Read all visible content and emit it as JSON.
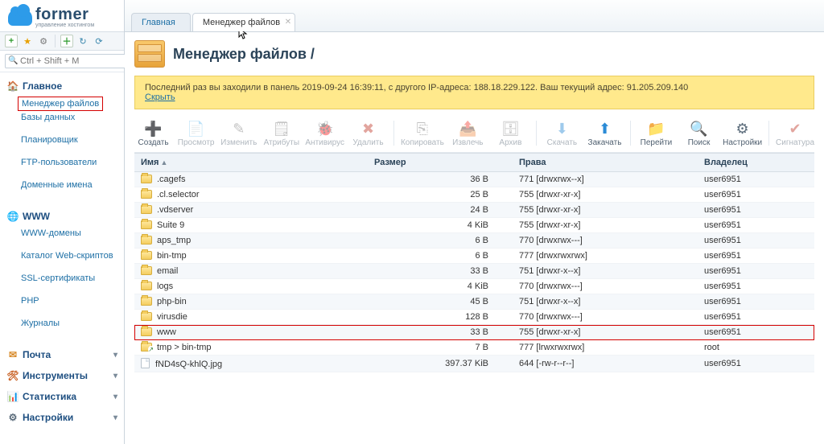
{
  "brand": {
    "name": "former",
    "tagline": "управление хостингом"
  },
  "search": {
    "placeholder": "Ctrl + Shift + M"
  },
  "nav": [
    {
      "label": "Главное",
      "icon": "home",
      "expanded": true,
      "items": [
        {
          "label": "Менеджер файлов",
          "highlight": true
        },
        {
          "label": "Базы данных"
        },
        {
          "label": "Планировщик"
        },
        {
          "label": "FTP-пользователи"
        },
        {
          "label": "Доменные имена"
        }
      ]
    },
    {
      "label": "WWW",
      "icon": "globe",
      "expanded": true,
      "items": [
        {
          "label": "WWW-домены"
        },
        {
          "label": "Каталог Web-скриптов"
        },
        {
          "label": "SSL-сертификаты"
        },
        {
          "label": "PHP"
        },
        {
          "label": "Журналы"
        }
      ]
    },
    {
      "label": "Почта",
      "icon": "mail",
      "expanded": false
    },
    {
      "label": "Инструменты",
      "icon": "tools",
      "expanded": false
    },
    {
      "label": "Статистика",
      "icon": "stats",
      "expanded": false
    },
    {
      "label": "Настройки",
      "icon": "gear",
      "expanded": false
    }
  ],
  "tabs": [
    {
      "label": "Главная",
      "active": false,
      "closable": false
    },
    {
      "label": "Менеджер файлов",
      "active": true,
      "closable": true
    }
  ],
  "page": {
    "title": "Менеджер файлов /"
  },
  "notice": {
    "text": "Последний раз вы заходили в панель 2019-09-24 16:39:11, с другого IP-адреса: 188.18.229.122. Ваш текущий адрес: 91.205.209.140",
    "hide_label": "Скрыть"
  },
  "actions": [
    {
      "key": "create",
      "label": "Создать",
      "icon": "➕",
      "color": "#3a9b3a"
    },
    {
      "key": "view",
      "label": "Просмотр",
      "icon": "📄",
      "disabled": true
    },
    {
      "key": "edit",
      "label": "Изменить",
      "icon": "✎",
      "disabled": true
    },
    {
      "key": "attrs",
      "label": "Атрибуты",
      "icon": "🗒",
      "disabled": true
    },
    {
      "key": "antivirus",
      "label": "Антивирус",
      "icon": "🐞",
      "disabled": true
    },
    {
      "key": "delete",
      "label": "Удалить",
      "icon": "✖",
      "disabled": true,
      "color": "#c0392b"
    },
    {
      "key": "sep1",
      "sep": true
    },
    {
      "key": "copy",
      "label": "Копировать",
      "icon": "⎘",
      "disabled": true
    },
    {
      "key": "extract",
      "label": "Извлечь",
      "icon": "📤",
      "disabled": true
    },
    {
      "key": "archive",
      "label": "Архив",
      "icon": "🗄",
      "disabled": true
    },
    {
      "key": "sep2",
      "sep": true
    },
    {
      "key": "download",
      "label": "Скачать",
      "icon": "⬇",
      "disabled": true,
      "color": "#2b8bd6"
    },
    {
      "key": "upload",
      "label": "Закачать",
      "icon": "⬆",
      "color": "#2b8bd6"
    },
    {
      "key": "sep3",
      "sep": true
    },
    {
      "key": "go",
      "label": "Перейти",
      "icon": "📁",
      "color": "#e5a83a"
    },
    {
      "key": "search",
      "label": "Поиск",
      "icon": "🔍",
      "color": "#2b8bd6"
    },
    {
      "key": "settings",
      "label": "Настройки",
      "icon": "⚙",
      "color": "#5a6b7a"
    },
    {
      "key": "sep4",
      "sep": true
    },
    {
      "key": "signature",
      "label": "Сигнатура",
      "icon": "✔",
      "disabled": true,
      "color": "#c0392b"
    }
  ],
  "columns": {
    "name": "Имя",
    "size": "Размер",
    "perm": "Права",
    "owner": "Владелец"
  },
  "files": [
    {
      "type": "folder",
      "name": ".cagefs",
      "size": "36 B",
      "perm": "771 [drwxrwx--x]",
      "owner": "user6951"
    },
    {
      "type": "folder",
      "name": ".cl.selector",
      "size": "25 B",
      "perm": "755 [drwxr-xr-x]",
      "owner": "user6951"
    },
    {
      "type": "folder",
      "name": ".vdserver",
      "size": "24 B",
      "perm": "755 [drwxr-xr-x]",
      "owner": "user6951"
    },
    {
      "type": "folder",
      "name": "Suite 9",
      "size": "4 KiB",
      "perm": "755 [drwxr-xr-x]",
      "owner": "user6951"
    },
    {
      "type": "folder",
      "name": "aps_tmp",
      "size": "6 B",
      "perm": "770 [drwxrwx---]",
      "owner": "user6951"
    },
    {
      "type": "folder",
      "name": "bin-tmp",
      "size": "6 B",
      "perm": "777 [drwxrwxrwx]",
      "owner": "user6951"
    },
    {
      "type": "folder",
      "name": "email",
      "size": "33 B",
      "perm": "751 [drwxr-x--x]",
      "owner": "user6951"
    },
    {
      "type": "folder",
      "name": "logs",
      "size": "4 KiB",
      "perm": "770 [drwxrwx---]",
      "owner": "user6951"
    },
    {
      "type": "folder",
      "name": "php-bin",
      "size": "45 B",
      "perm": "751 [drwxr-x--x]",
      "owner": "user6951"
    },
    {
      "type": "folder",
      "name": "virusdie",
      "size": "128 B",
      "perm": "770 [drwxrwx---]",
      "owner": "user6951"
    },
    {
      "type": "folder",
      "name": "www",
      "size": "33 B",
      "perm": "755 [drwxr-xr-x]",
      "owner": "user6951",
      "highlight": true
    },
    {
      "type": "link",
      "name": "tmp > bin-tmp",
      "size": "7 B",
      "perm": "777 [lrwxrwxrwx]",
      "owner": "root"
    },
    {
      "type": "file",
      "name": "fND4sQ-khlQ.jpg",
      "size": "397.37 KiB",
      "perm": "644 [-rw-r--r--]",
      "owner": "user6951"
    }
  ]
}
